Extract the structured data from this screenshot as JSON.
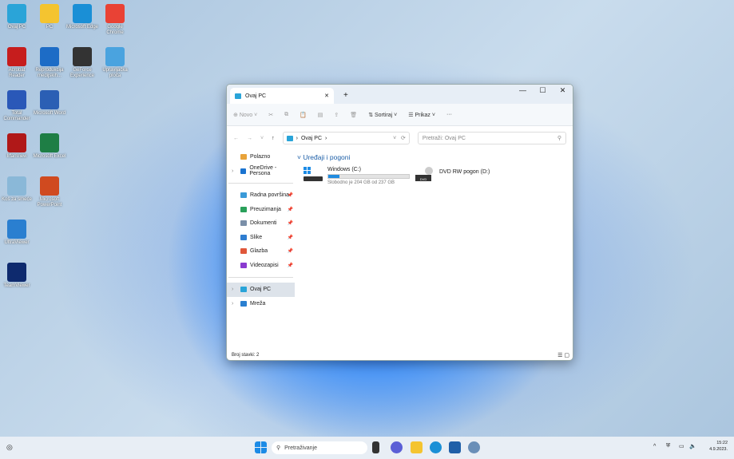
{
  "desktop_icons": [
    {
      "label": "Ovaj PC",
      "color": "#2aa4d8"
    },
    {
      "label": "PC",
      "color": "#f4c430"
    },
    {
      "label": "Microsoft Edge",
      "color": "#1a8fd6"
    },
    {
      "label": "Google Chrome",
      "color": "#e94235"
    },
    {
      "label": "Acrobat Reader",
      "color": "#c61d1d"
    },
    {
      "label": "Reprodukcija medijskih...",
      "color": "#1d6cc6"
    },
    {
      "label": "GeForce Experience",
      "color": "#333333"
    },
    {
      "label": "Upravljačka ploča",
      "color": "#4aa3df"
    },
    {
      "label": "Total Commander",
      "color": "#2a58b8"
    },
    {
      "label": "Microsoft Word",
      "color": "#2b5fb4"
    },
    {
      "label": "IrfanView",
      "color": "#b01818"
    },
    {
      "label": "Microsoft Excel",
      "color": "#1e7e45"
    },
    {
      "label": "Koš za smeće",
      "color": "#8ab8d8"
    },
    {
      "label": "Microsoft PowerPoint",
      "color": "#d04a1f"
    },
    {
      "label": "UltraViewer",
      "color": "#2a7fd0"
    },
    {
      "label": "TeamViewer",
      "color": "#0e2a6e"
    }
  ],
  "window": {
    "tab_title": "Ovaj PC",
    "toolbar": {
      "new": "Novo",
      "sort": "Sortiraj",
      "view": "Prikaz",
      "more": "···"
    },
    "address": {
      "path": "Ovaj PC"
    },
    "search_placeholder": "Pretraži: Ovaj PC",
    "sidebar": [
      {
        "label": "Polazno",
        "color": "#e8a33a"
      },
      {
        "label": "OneDrive - Persona",
        "color": "#1a73d0"
      }
    ],
    "quick_access": [
      {
        "label": "Radna površina",
        "color": "#3a9ad8"
      },
      {
        "label": "Preuzimanja",
        "color": "#2aa05a"
      },
      {
        "label": "Dokumenti",
        "color": "#7a8fa8"
      },
      {
        "label": "Slike",
        "color": "#2f7dd0"
      },
      {
        "label": "Glazba",
        "color": "#e0573a"
      },
      {
        "label": "Videozapisi",
        "color": "#8a3ad0"
      }
    ],
    "nav_bottom": [
      {
        "label": "Ovaj PC",
        "color": "#2aa4d8"
      },
      {
        "label": "Mreža",
        "color": "#2a7fd0"
      }
    ],
    "group_title": "Uređaji i pogoni",
    "drives": [
      {
        "name": "Windows (C:)",
        "free_text": "Slobodno je 204 GB od 237 GB",
        "used_fraction": 0.14
      },
      {
        "name": "DVD RW pogon (D:)",
        "badge": "DVD"
      }
    ],
    "status": "Broj stavki: 2"
  },
  "taskbar": {
    "search": "Pretraživanje",
    "time": "15:22",
    "date": "4.9.2023."
  }
}
